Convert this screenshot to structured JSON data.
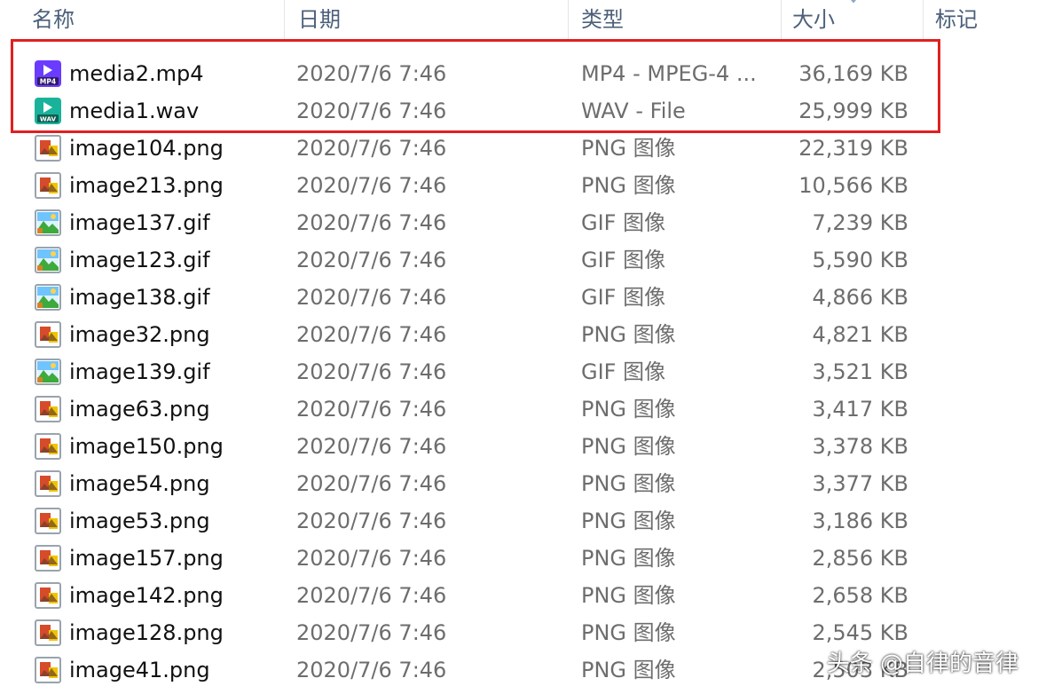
{
  "header": {
    "name": "名称",
    "date": "日期",
    "type": "类型",
    "size": "大小",
    "tag": "标记"
  },
  "files": [
    {
      "name": "media2.mp4",
      "date": "2020/7/6 7:46",
      "type": "MP4 - MPEG-4 ...",
      "size": "36,169 KB",
      "icon": "mp4-file-icon"
    },
    {
      "name": "media1.wav",
      "date": "2020/7/6 7:46",
      "type": "WAV - File",
      "size": "25,999 KB",
      "icon": "wav-file-icon"
    },
    {
      "name": "image104.png",
      "date": "2020/7/6 7:46",
      "type": "PNG 图像",
      "size": "22,319 KB",
      "icon": "png-file-icon"
    },
    {
      "name": "image213.png",
      "date": "2020/7/6 7:46",
      "type": "PNG 图像",
      "size": "10,566 KB",
      "icon": "png-file-icon"
    },
    {
      "name": "image137.gif",
      "date": "2020/7/6 7:46",
      "type": "GIF 图像",
      "size": "7,239 KB",
      "icon": "gif-file-icon"
    },
    {
      "name": "image123.gif",
      "date": "2020/7/6 7:46",
      "type": "GIF 图像",
      "size": "5,590 KB",
      "icon": "gif-file-icon"
    },
    {
      "name": "image138.gif",
      "date": "2020/7/6 7:46",
      "type": "GIF 图像",
      "size": "4,866 KB",
      "icon": "gif-file-icon"
    },
    {
      "name": "image32.png",
      "date": "2020/7/6 7:46",
      "type": "PNG 图像",
      "size": "4,821 KB",
      "icon": "png-file-icon"
    },
    {
      "name": "image139.gif",
      "date": "2020/7/6 7:46",
      "type": "GIF 图像",
      "size": "3,521 KB",
      "icon": "gif-file-icon"
    },
    {
      "name": "image63.png",
      "date": "2020/7/6 7:46",
      "type": "PNG 图像",
      "size": "3,417 KB",
      "icon": "png-file-icon"
    },
    {
      "name": "image150.png",
      "date": "2020/7/6 7:46",
      "type": "PNG 图像",
      "size": "3,378 KB",
      "icon": "png-file-icon"
    },
    {
      "name": "image54.png",
      "date": "2020/7/6 7:46",
      "type": "PNG 图像",
      "size": "3,377 KB",
      "icon": "png-file-icon"
    },
    {
      "name": "image53.png",
      "date": "2020/7/6 7:46",
      "type": "PNG 图像",
      "size": "3,186 KB",
      "icon": "png-file-icon"
    },
    {
      "name": "image157.png",
      "date": "2020/7/6 7:46",
      "type": "PNG 图像",
      "size": "2,856 KB",
      "icon": "png-file-icon"
    },
    {
      "name": "image142.png",
      "date": "2020/7/6 7:46",
      "type": "PNG 图像",
      "size": "2,658 KB",
      "icon": "png-file-icon"
    },
    {
      "name": "image128.png",
      "date": "2020/7/6 7:46",
      "type": "PNG 图像",
      "size": "2,545 KB",
      "icon": "png-file-icon"
    },
    {
      "name": "image41.png",
      "date": "2020/7/6 7:46",
      "type": "PNG 图像",
      "size": "2,503 KB",
      "icon": "png-file-icon"
    }
  ],
  "watermark": "头条 @自律的音律",
  "colors": {
    "highlight_border": "#e02020",
    "header_text": "#4c607a",
    "secondary_text": "#6d6d6d"
  }
}
